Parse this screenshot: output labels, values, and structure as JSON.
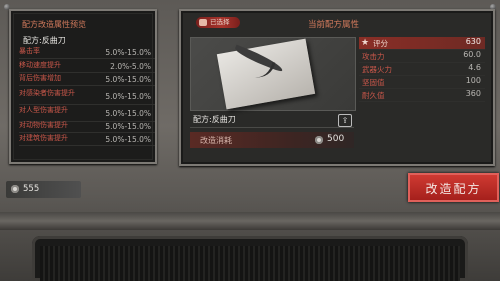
{
  "left_panel": {
    "title": "配方改造属性预览",
    "recipe": "配方:反曲刀",
    "rows": [
      {
        "label": "暴击率",
        "value": "5.0%-15.0%"
      },
      {
        "label": "移动速度提升",
        "value": "2.0%-5.0%"
      },
      {
        "label": "背后伤害增加",
        "value": "5.0%-15.0%"
      },
      {
        "label": "对感染者伤害提升",
        "value": "5.0%-15.0%"
      },
      {
        "label": "对人型伤害提升",
        "value": "5.0%-15.0%"
      },
      {
        "label": "对动物伤害提升",
        "value": "5.0%-15.0%"
      },
      {
        "label": "对建筑伤害提升",
        "value": "5.0%-15.0%"
      }
    ]
  },
  "right_panel": {
    "badge": "已选择",
    "title": "当前配方属性",
    "item_name": "配方:反曲刀",
    "cost_label": "改造消耗",
    "cost": "500",
    "stats": [
      {
        "label": "评分",
        "value": "630",
        "highlight": true
      },
      {
        "label": "攻击力",
        "value": "60.0"
      },
      {
        "label": "武器火力",
        "value": "4.6"
      },
      {
        "label": "坚固值",
        "value": "100"
      },
      {
        "label": "耐久值",
        "value": "360"
      }
    ]
  },
  "currency": {
    "amount": "555"
  },
  "modify_button": {
    "label": "改造配方"
  },
  "colors": {
    "accent_red": "#c9574a",
    "button_red": "#b82a24"
  }
}
